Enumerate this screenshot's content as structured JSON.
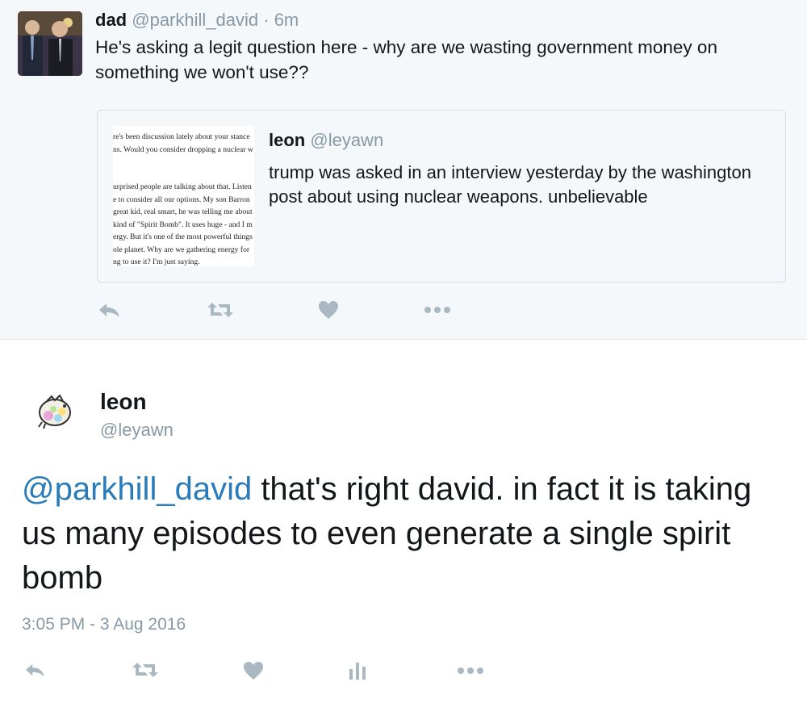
{
  "top_tweet": {
    "author_name": "dad",
    "author_handle": "@parkhill_david",
    "separator": "·",
    "time": "6m",
    "text": "He's asking a legit question here - why are we wasting government money on something we won't use??",
    "quote": {
      "author_name": "leon",
      "author_handle": "@leyawn",
      "text": "trump was asked in an interview yesterday by the washington post about using nuclear weapons. unbelievable",
      "image_lines": [
        "re's been discussion lately about your stance",
        "ns. Would you consider dropping a nuclear w",
        "",
        "",
        "urprised people are talking about that. Listen",
        "e to consider all our options. My son Barron",
        "great kid, real smart, he was telling me about",
        "kind of \"Spirit Bomb\". It uses huge - and I m",
        "ergy. But it's one of the most powerful things",
        "ole planet. Why are we gathering energy for",
        "ng to use it? I'm just saying."
      ]
    },
    "actions": [
      "reply-icon",
      "retweet-icon",
      "like-icon",
      "more-icon"
    ]
  },
  "main_tweet": {
    "author_name": "leon",
    "author_handle": "@leyawn",
    "mention": "@parkhill_david",
    "text": " that's right david. in fact it is taking us many episodes to even generate a single spirit bomb",
    "timestamp": "3:05 PM - 3 Aug 2016",
    "actions": [
      "reply-icon",
      "retweet-icon",
      "like-icon",
      "analytics-icon",
      "more-icon"
    ]
  },
  "colors": {
    "icon_gray": "#aab8c2",
    "handle_gray": "#8899a6",
    "link_blue": "#2b7bb9",
    "card_bg": "#f5f8fa"
  }
}
